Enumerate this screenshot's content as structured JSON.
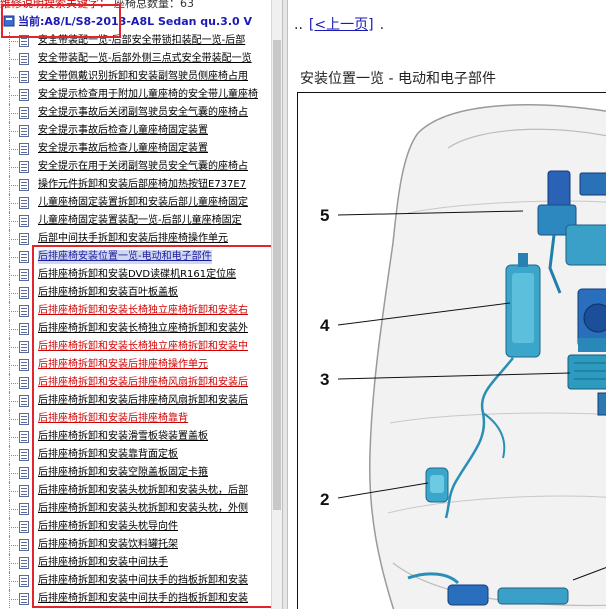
{
  "left_pane": {
    "search_label": "维修说明搜索关键字：",
    "search_value": "座椅总数量：63",
    "current_node": "当前:A8/L/S8-2013-A8L Sedan qu.3.0 V",
    "items": [
      {
        "label": "安全带装配一览-后部安全带锁扣装配一览-后部",
        "style": "black"
      },
      {
        "label": "安全带装配一览-后部外侧三点式安全带装配一览",
        "style": "black"
      },
      {
        "label": "安全带佩戴识别拆卸和安装副驾驶员侧座椅占用",
        "style": "black"
      },
      {
        "label": "安全提示检查用于附加儿童座椅的安全带儿童座椅",
        "style": "black"
      },
      {
        "label": "安全提示事故后关闭副驾驶员安全气囊的座椅占",
        "style": "black"
      },
      {
        "label": "安全提示事故后检查儿童座椅固定装置",
        "style": "black"
      },
      {
        "label": "安全提示事故后检查儿童座椅固定装置",
        "style": "black"
      },
      {
        "label": "安全提示在用于关闭副驾驶员安全气囊的座椅占",
        "style": "black"
      },
      {
        "label": "操作元件拆卸和安装后部座椅加热按钮E737E7",
        "style": "black"
      },
      {
        "label": "儿童座椅固定装置拆卸和安装后部儿童座椅固定",
        "style": "black"
      },
      {
        "label": "儿童座椅固定装置装配一览-后部儿童座椅固定",
        "style": "black"
      },
      {
        "label": "后部中间扶手拆卸和安装后排座椅操作单元",
        "style": "black"
      },
      {
        "label": "后排座椅安装位置一览-电动和电子部件",
        "style": "red",
        "selected": true
      },
      {
        "label": "后排座椅拆卸和安装DVD读碟机R161定位座",
        "style": "black"
      },
      {
        "label": "后排座椅拆卸和安装百叶板盖板",
        "style": "black"
      },
      {
        "label": "后排座椅拆卸和安装长椅独立座椅拆卸和安装右",
        "style": "red"
      },
      {
        "label": "后排座椅拆卸和安装长椅独立座椅拆卸和安装外",
        "style": "black"
      },
      {
        "label": "后排座椅拆卸和安装长椅独立座椅拆卸和安装中",
        "style": "red"
      },
      {
        "label": "后排座椅拆卸和安装后排座椅操作单元",
        "style": "red"
      },
      {
        "label": "后排座椅拆卸和安装后排座椅风扇拆卸和安装后",
        "style": "red"
      },
      {
        "label": "后排座椅拆卸和安装后排座椅风扇拆卸和安装后",
        "style": "black"
      },
      {
        "label": "后排座椅拆卸和安装后排座椅靠背",
        "style": "red"
      },
      {
        "label": "后排座椅拆卸和安装滑雪板袋装置盖板",
        "style": "black"
      },
      {
        "label": "后排座椅拆卸和安装靠背面定板",
        "style": "black"
      },
      {
        "label": "后排座椅拆卸和安装空隙盖板固定卡箍",
        "style": "black"
      },
      {
        "label": "后排座椅拆卸和安装头枕拆卸和安装头枕，后部",
        "style": "black"
      },
      {
        "label": "后排座椅拆卸和安装头枕拆卸和安装头枕，外侧",
        "style": "black"
      },
      {
        "label": "后排座椅拆卸和安装头枕导向件",
        "style": "black"
      },
      {
        "label": "后排座椅拆卸和安装饮料罐托架",
        "style": "black"
      },
      {
        "label": "后排座椅拆卸和安装中间扶手",
        "style": "black"
      },
      {
        "label": "后排座椅拆卸和安装中间扶手的挡板拆卸和安装",
        "style": "black"
      },
      {
        "label": "后排座椅拆卸和安装中间扶手的挡板拆卸和安装",
        "style": "black"
      }
    ]
  },
  "right_pane": {
    "nav_prefix": "..",
    "prev_link": "[<上一页]",
    "nav_suffix": ".",
    "section_title": "安装位置一览 - 电动和电子部件",
    "callouts": [
      "5",
      "4",
      "3",
      "2"
    ]
  },
  "colors": {
    "highlight_border": "#e0262b",
    "link_blue": "#1a1ab5",
    "red_item": "#d00000",
    "component_cyan": "#2aa3c8"
  }
}
